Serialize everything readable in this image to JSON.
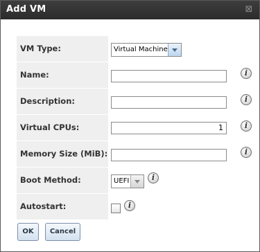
{
  "window": {
    "title": "Add VM",
    "close_glyph": "⊠"
  },
  "form": {
    "vm_type": {
      "label": "VM Type:",
      "value": "Virtual Machine"
    },
    "name": {
      "label": "Name:",
      "value": ""
    },
    "description": {
      "label": "Description:",
      "value": ""
    },
    "virtual_cpus": {
      "label": "Virtual CPUs:",
      "value": "1"
    },
    "memory_size": {
      "label": "Memory Size (MiB):",
      "value": ""
    },
    "boot_method": {
      "label": "Boot Method:",
      "value": "UEFI"
    },
    "autostart": {
      "label": "Autostart:",
      "checked": false
    }
  },
  "info_glyph": "i",
  "buttons": {
    "ok": "OK",
    "cancel": "Cancel"
  },
  "colors": {
    "titlebar": "#2b2b2b",
    "label_bg": "#efefef",
    "button_bg": "#d3e1ef"
  }
}
